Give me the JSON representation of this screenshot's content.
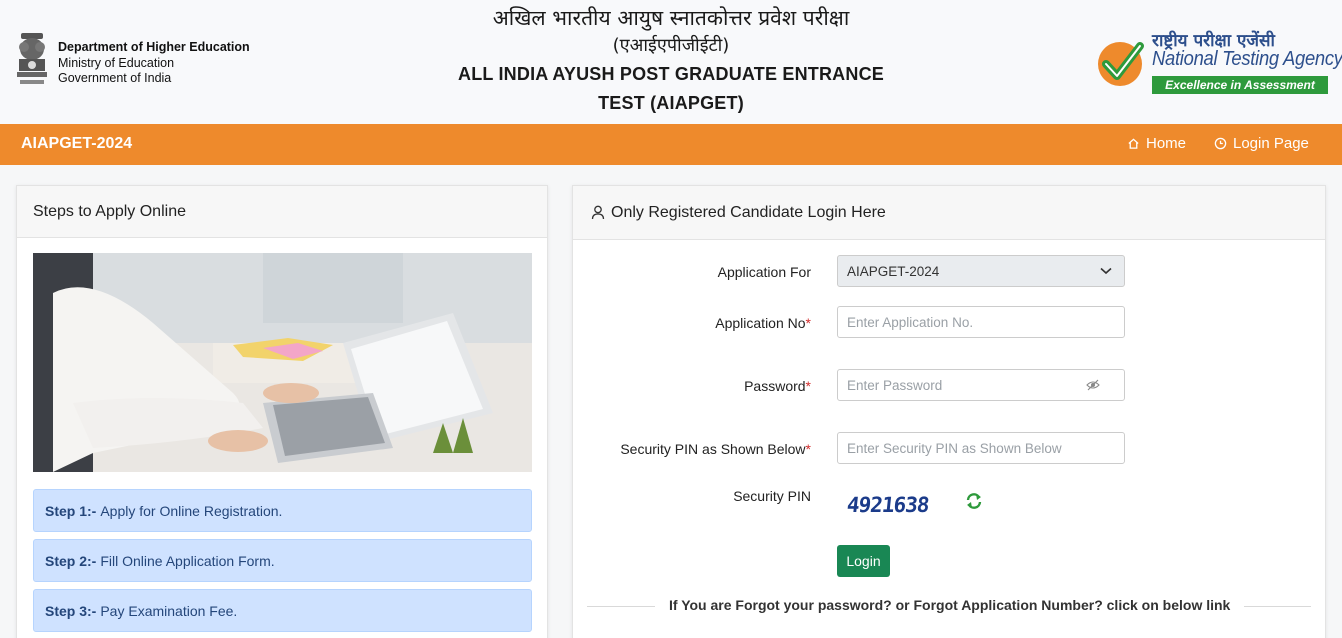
{
  "header": {
    "dept_line1": "Department of Higher Education",
    "dept_line2": "Ministry of Education",
    "dept_line3": "Government of India",
    "title_hi_1": "अखिल भारतीय आयुष स्नातकोत्तर प्रवेश परीक्षा",
    "title_hi_2": "(एआईएपीजीईटी)",
    "title_en_1": "ALL INDIA AYUSH POST GRADUATE ENTRANCE",
    "title_en_2": "TEST (AIAPGET)",
    "nta_hindi": "राष्ट्रीय परीक्षा एजेंसी",
    "nta_name": "National Testing Agency",
    "nta_tagline": "Excellence in Assessment"
  },
  "nav": {
    "brand": "AIAPGET-2024",
    "home": "Home",
    "login_page": "Login Page"
  },
  "steps_panel": {
    "title": "Steps to Apply Online",
    "steps": [
      {
        "label": "Step 1:-",
        "text": "Apply for Online Registration."
      },
      {
        "label": "Step 2:-",
        "text": "Fill Online Application Form."
      },
      {
        "label": "Step 3:-",
        "text": "Pay Examination Fee."
      }
    ]
  },
  "login_panel": {
    "title": "Only Registered Candidate Login Here",
    "application_for_label": "Application For",
    "application_for_value": "AIAPGET-2024",
    "application_no_label": "Application No",
    "application_no_placeholder": "Enter Application No.",
    "password_label": "Password",
    "password_placeholder": "Enter Password",
    "pin_label": "Security PIN as Shown Below",
    "pin_placeholder": "Enter Security PIN as Shown Below",
    "security_pin_label": "Security PIN",
    "captcha_value": "4921638",
    "required_mark": "*",
    "login_button": "Login",
    "forgot_text": "If You are Forgot your password? or Forgot Application Number? click on below link"
  },
  "colors": {
    "navbar": "#ee8a2c",
    "step_bg": "#cfe2ff",
    "login_button": "#198754",
    "nta_green": "#2e9a3c",
    "nta_blue": "#2d4f8c"
  }
}
